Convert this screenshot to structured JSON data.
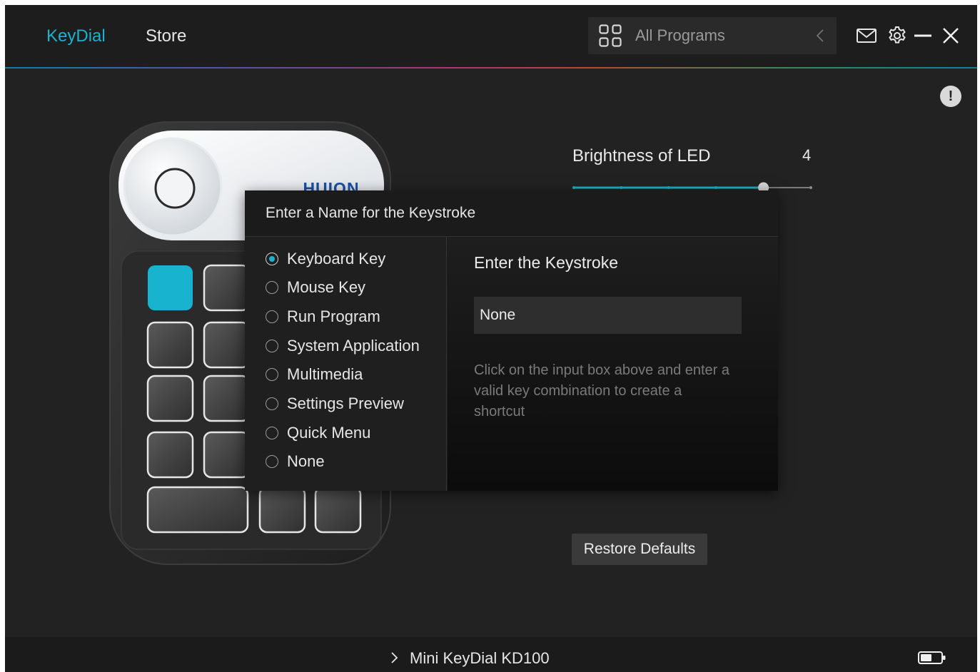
{
  "header": {
    "tabs": [
      {
        "label": "KeyDial",
        "active": true
      },
      {
        "label": "Store",
        "active": false
      }
    ],
    "program_selector": {
      "label": "All Programs",
      "icon": "grid-icon"
    },
    "icons": [
      "mail-icon",
      "gear-icon",
      "minimize-icon",
      "close-icon"
    ]
  },
  "device": {
    "brand": "HUION",
    "selected_key_color": "#17b3cf"
  },
  "brightness": {
    "label": "Brightness of LED",
    "value": "4",
    "max": 5,
    "accent": "#1ab2cf"
  },
  "popup": {
    "title": "Enter a Name for the Keystroke",
    "options": [
      {
        "label": "Keyboard Key",
        "checked": true
      },
      {
        "label": "Mouse Key",
        "checked": false
      },
      {
        "label": "Run Program",
        "checked": false
      },
      {
        "label": "System Application",
        "checked": false
      },
      {
        "label": "Multimedia",
        "checked": false
      },
      {
        "label": "Settings Preview",
        "checked": false
      },
      {
        "label": "Quick Menu",
        "checked": false
      },
      {
        "label": "None",
        "checked": false
      }
    ],
    "keystroke_title": "Enter the Keystroke",
    "keystroke_value": "None",
    "keystroke_hint": "Click on the input box above and enter a valid key combination to create a shortcut"
  },
  "restore_label": "Restore Defaults",
  "footer": {
    "device_name": "Mini KeyDial KD100",
    "icon": "battery-icon"
  }
}
